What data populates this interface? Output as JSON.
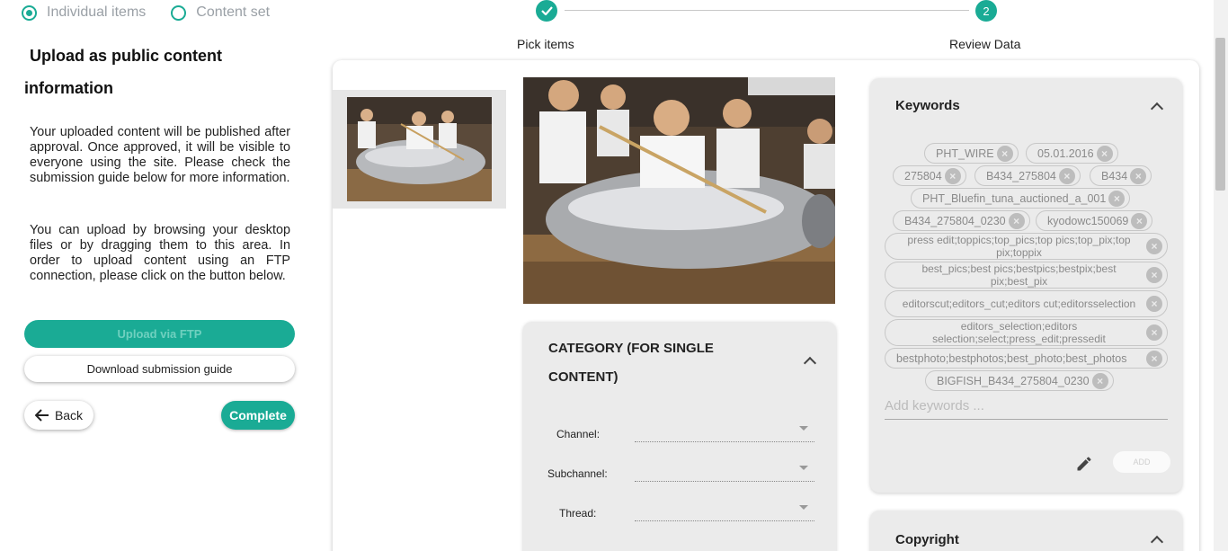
{
  "mode_radios": [
    {
      "label": "Individual items",
      "selected": true
    },
    {
      "label": "Content set",
      "selected": false
    }
  ],
  "left": {
    "title_line1": "Upload as public content",
    "title_line2": "information",
    "para1": "Your uploaded content will be published after approval. Once approved, it will be visible to everyone using the site. Please check the submission guide below for more information.",
    "para2": "You can upload by browsing your desktop files or by dragging them to this area. In order to upload content using an FTP connection, please click on the button below.",
    "ftp_button": "Upload via FTP",
    "guide_button": "Download submission guide",
    "back_button": "Back",
    "complete_button": "Complete"
  },
  "stepper": {
    "step1_label": "Pick items",
    "step2_number": "2",
    "step2_label": "Review Data"
  },
  "category": {
    "title": "CATEGORY (FOR SINGLE CONTENT)",
    "fields": [
      "Channel:",
      "Subchannel:",
      "Thread:"
    ]
  },
  "keywords": {
    "title": "Keywords",
    "chips": [
      "PHT_WIRE",
      "05.01.2016",
      "275804",
      "B434_275804",
      "B434",
      "PHT_Bluefin_tuna_auctioned_a_001",
      "B434_275804_0230",
      "kyodowc150069",
      "press edit;toppics;top_pics;top pics;top_pix;top pix;toppix",
      "best_pics;best pics;bestpics;bestpix;best pix;best_pix",
      "editorscut;editors_cut;editors cut;editorsselection",
      "editors_selection;editors selection;select;press_edit;pressedit",
      "bestphoto;bestphotos;best_photo;best_photos",
      "BIGFISH_B434_275804_0230"
    ],
    "input_placeholder": "Add keywords ...",
    "add_button": "ADD"
  },
  "copyright": {
    "title": "Copyright"
  },
  "colors": {
    "accent": "#1aab95",
    "panel": "#ebebeb"
  }
}
